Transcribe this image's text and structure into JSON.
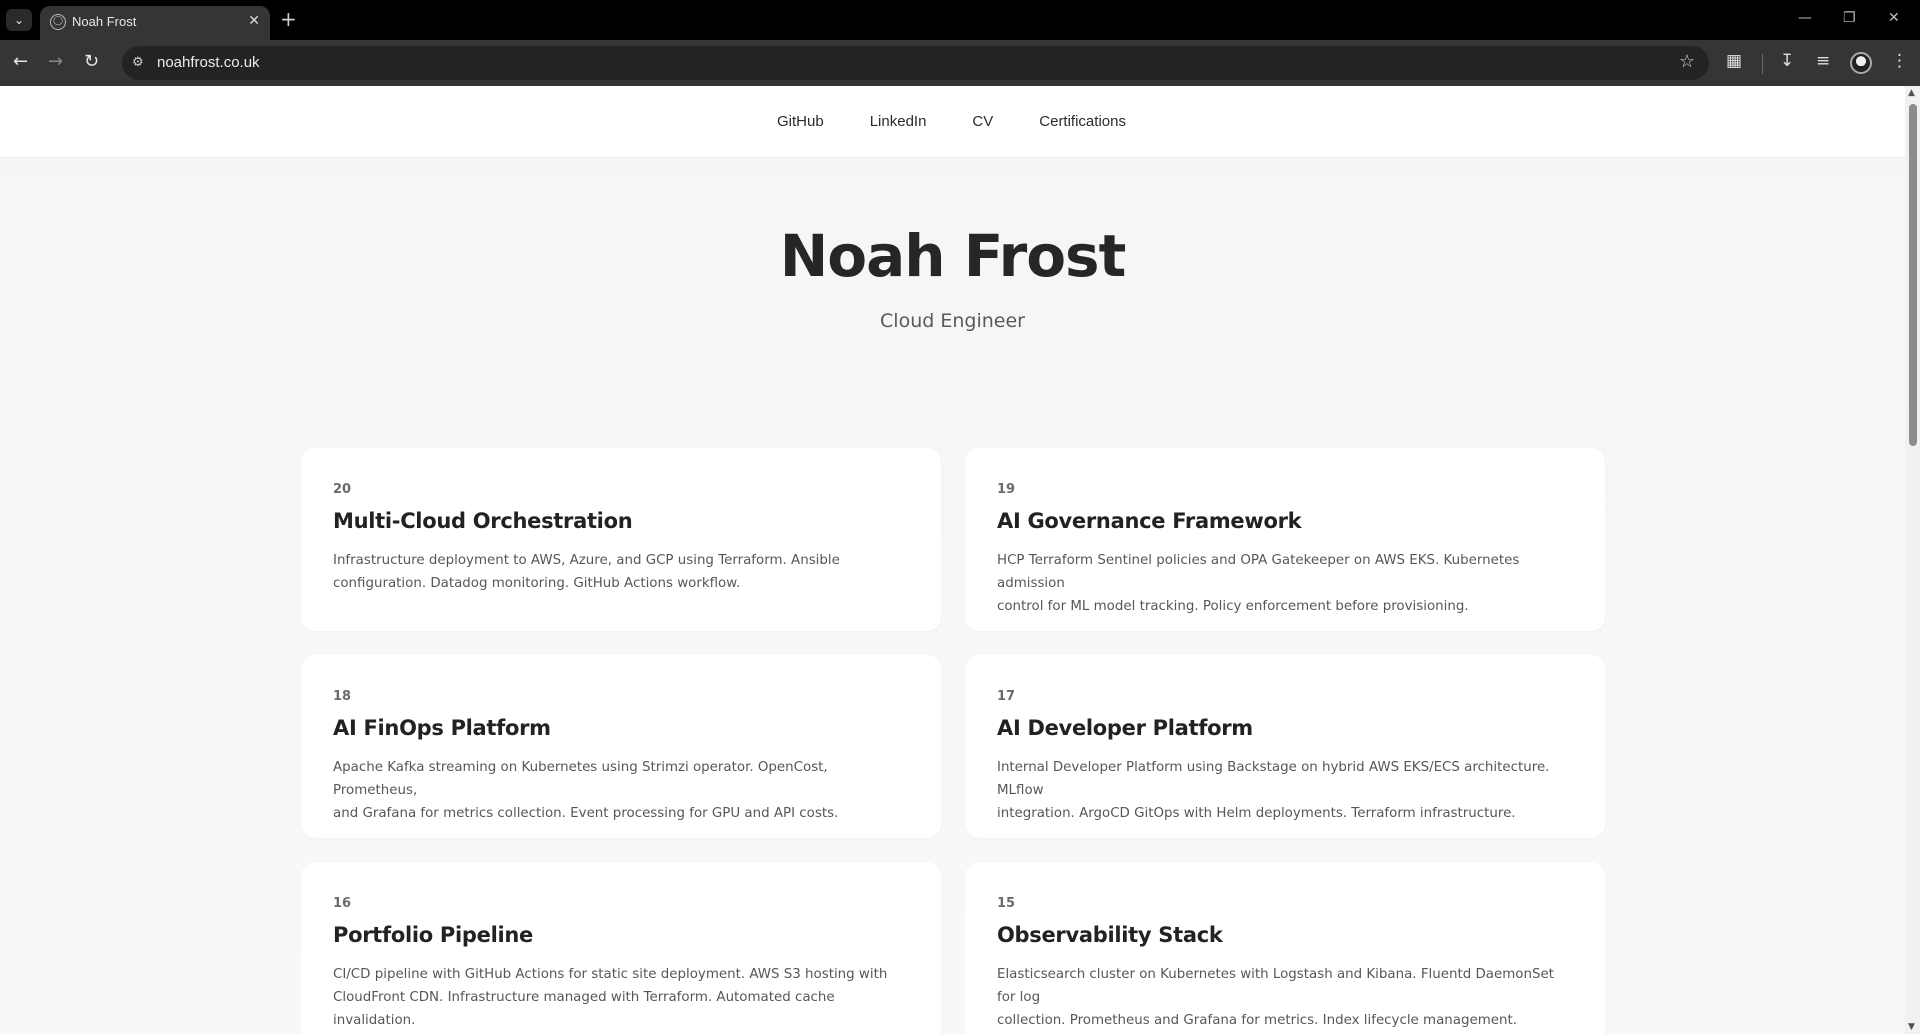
{
  "browser": {
    "tab_title": "Noah Frost",
    "url": "noahfrost.co.uk",
    "icons": {
      "tab_search": "chevron-down-icon",
      "favicon": "globe-icon",
      "close": "close-icon",
      "new_tab": "plus-icon",
      "back": "arrow-left-icon",
      "forward": "arrow-right-icon",
      "reload": "reload-icon",
      "site_info": "tune-icon",
      "bookmark": "star-icon",
      "extensions": "puzzle-icon",
      "downloads": "download-icon",
      "media": "media-list-icon",
      "menu": "more-vertical-icon"
    }
  },
  "site_nav": {
    "items": [
      "GitHub",
      "LinkedIn",
      "CV",
      "Certifications"
    ]
  },
  "hero": {
    "name": "Noah Frost",
    "role": "Cloud Engineer"
  },
  "projects": [
    {
      "number": "20",
      "title": "Multi-Cloud Orchestration",
      "line1": "Infrastructure deployment to AWS, Azure, and GCP using Terraform. Ansible",
      "line2": "configuration. Datadog monitoring. GitHub Actions workflow."
    },
    {
      "number": "19",
      "title": "AI Governance Framework",
      "line1": "HCP Terraform Sentinel policies and OPA Gatekeeper on AWS EKS. Kubernetes admission",
      "line2": "control for ML model tracking. Policy enforcement before provisioning."
    },
    {
      "number": "18",
      "title": "AI FinOps Platform",
      "line1": "Apache Kafka streaming on Kubernetes using Strimzi operator. OpenCost, Prometheus,",
      "line2": "and Grafana for metrics collection. Event processing for GPU and API costs."
    },
    {
      "number": "17",
      "title": "AI Developer Platform",
      "line1": "Internal Developer Platform using Backstage on hybrid AWS EKS/ECS architecture. MLflow",
      "line2": "integration. ArgoCD GitOps with Helm deployments. Terraform infrastructure."
    },
    {
      "number": "16",
      "title": "Portfolio Pipeline",
      "line1": "CI/CD pipeline with GitHub Actions for static site deployment. AWS S3 hosting with",
      "line2": "CloudFront CDN. Infrastructure managed with Terraform. Automated cache invalidation."
    },
    {
      "number": "15",
      "title": "Observability Stack",
      "line1": "Elasticsearch cluster on Kubernetes with Logstash and Kibana. Fluentd DaemonSet for log",
      "line2": "collection. Prometheus and Grafana for metrics. Index lifecycle management."
    }
  ]
}
